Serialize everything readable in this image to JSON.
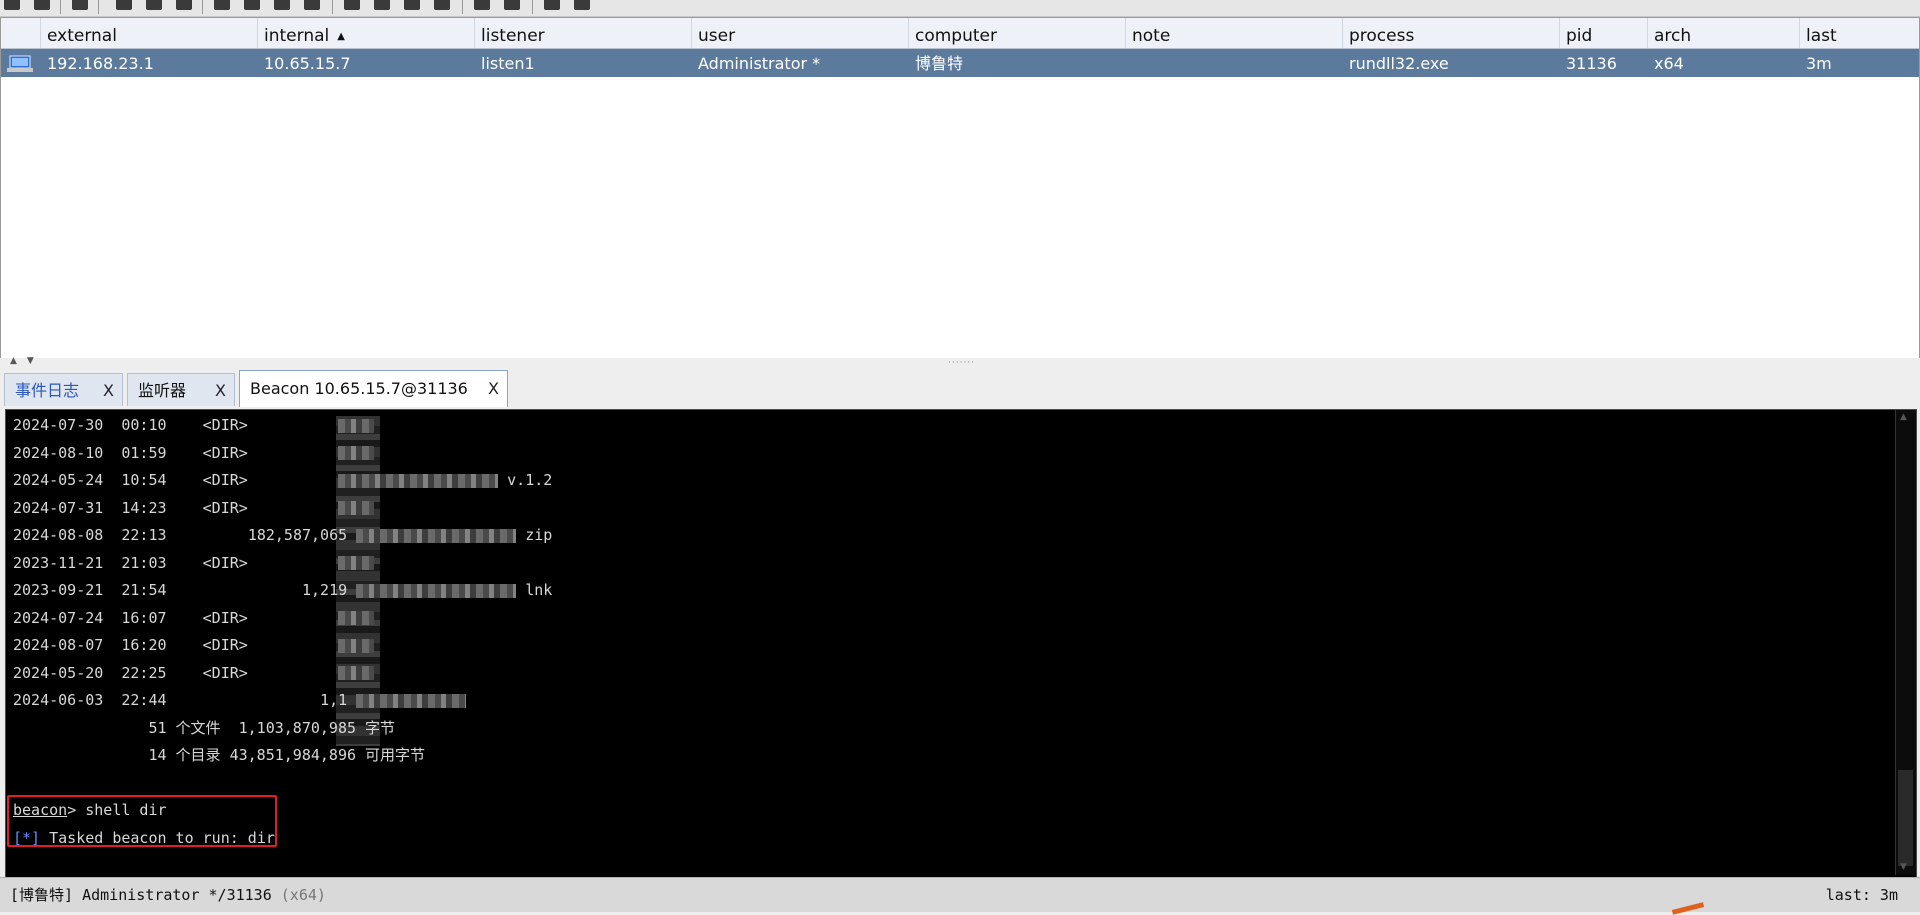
{
  "table": {
    "headers": [
      "external",
      "internal",
      "listener",
      "user",
      "computer",
      "note",
      "process",
      "pid",
      "arch",
      "last"
    ],
    "row": {
      "external": "192.168.23.1",
      "internal": "10.65.15.7",
      "listener": "listen1",
      "user": "Administrator *",
      "computer": "博鲁特",
      "note": "",
      "process": "rundll32.exe",
      "pid": "31136",
      "arch": "x64",
      "last": "3m"
    }
  },
  "tabs": [
    {
      "label": "事件日志",
      "close": "X"
    },
    {
      "label": "监听器",
      "close": "X"
    },
    {
      "label": "Beacon 10.65.15.7@31136",
      "close": "X"
    }
  ],
  "console": {
    "entries": [
      {
        "date": "2024-07-30",
        "time": "00:10",
        "type": "<DIR>",
        "size": "",
        "suffix": ""
      },
      {
        "date": "2024-08-10",
        "time": "01:59",
        "type": "<DIR>",
        "size": "",
        "suffix": ""
      },
      {
        "date": "2024-05-24",
        "time": "10:54",
        "type": "<DIR>",
        "size": "",
        "suffix": "v.1.2"
      },
      {
        "date": "2024-07-31",
        "time": "14:23",
        "type": "<DIR>",
        "size": "",
        "suffix": ""
      },
      {
        "date": "2024-08-08",
        "time": "22:13",
        "type": "",
        "size": "182,587,065",
        "suffix": "zip"
      },
      {
        "date": "2023-11-21",
        "time": "21:03",
        "type": "<DIR>",
        "size": "",
        "suffix": ""
      },
      {
        "date": "2023-09-21",
        "time": "21:54",
        "type": "",
        "size": "1,219",
        "suffix": "lnk"
      },
      {
        "date": "2024-07-24",
        "time": "16:07",
        "type": "<DIR>",
        "size": "",
        "suffix": ""
      },
      {
        "date": "2024-08-07",
        "time": "16:20",
        "type": "<DIR>",
        "size": "",
        "suffix": ""
      },
      {
        "date": "2024-05-20",
        "time": "22:25",
        "type": "<DIR>",
        "size": "",
        "suffix": ""
      },
      {
        "date": "2024-06-03",
        "time": "22:44",
        "type": "",
        "size": "1,1",
        "suffix": ""
      }
    ],
    "summary_files": "51 个文件  1,103,870,985 字节",
    "summary_dirs": "14 个目录 43,851,984,896 可用字节",
    "prompt": "beacon",
    "command": "> shell dir",
    "task_marker": "[*]",
    "task_text": " Tasked beacon to run: dir"
  },
  "status": {
    "host": "[博鲁特]",
    "user_pid": " Administrator */31136 ",
    "arch": "(x64)",
    "last": "last: 3m"
  },
  "icons": [
    "toolbar-icons",
    "computer-icon",
    "scroll-arrow-icons"
  ],
  "colors": {
    "selected_row": "#5c7a9c",
    "console_bg": "#000000",
    "highlight": "#e02020",
    "tab_blue": "#2b56c0"
  }
}
